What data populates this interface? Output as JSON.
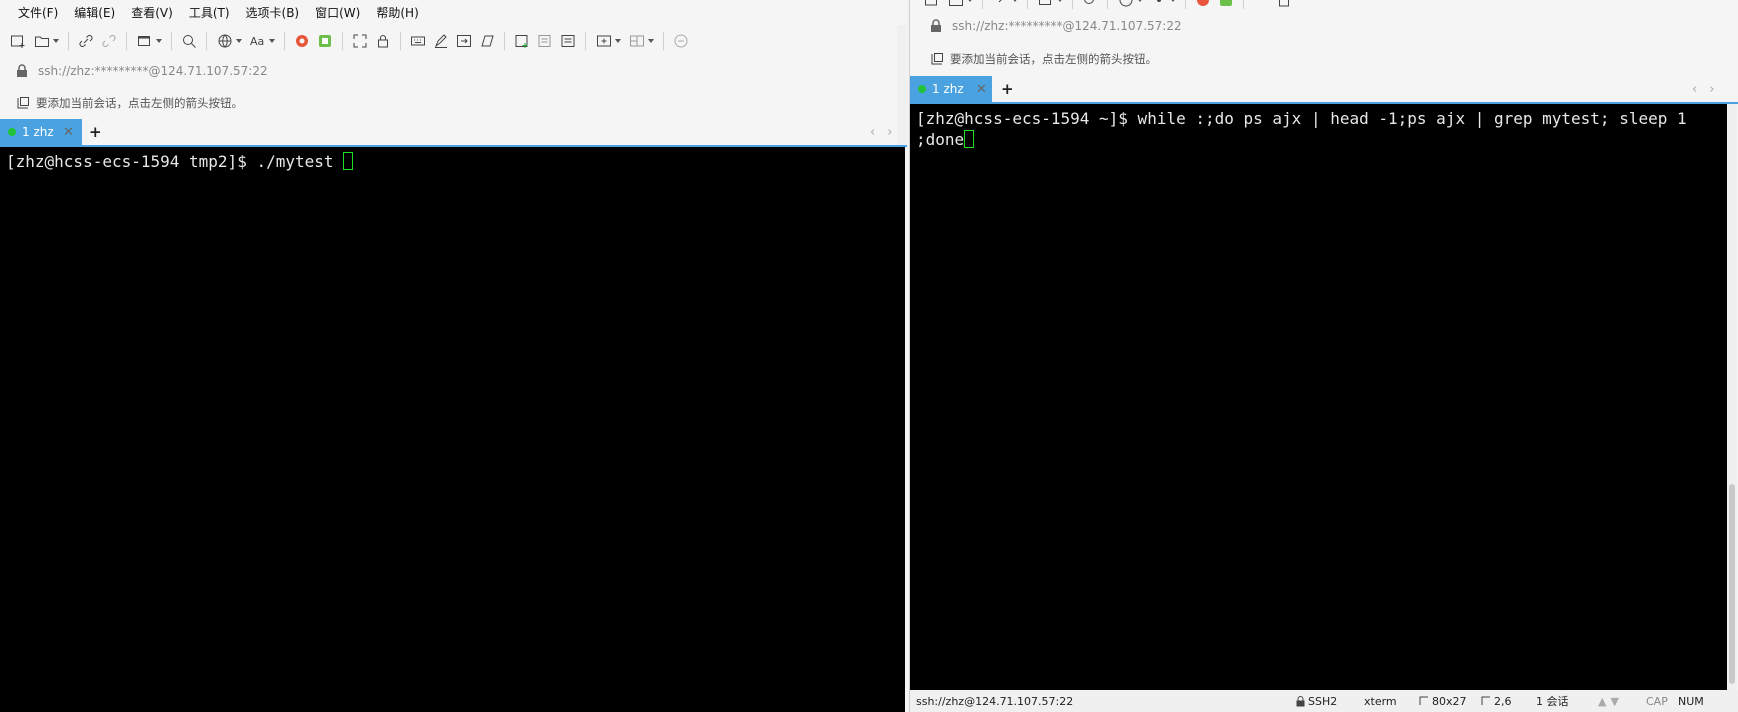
{
  "left": {
    "menu": [
      "文件(F)",
      "编辑(E)",
      "查看(V)",
      "工具(T)",
      "选项卡(B)",
      "窗口(W)",
      "帮助(H)"
    ],
    "address": "ssh://zhz:*********@124.71.107.57:22",
    "hint": "要添加当前会话，点击左侧的箭头按钮。",
    "tab_label": "1 zhz",
    "terminal_line": "[zhz@hcss-ecs-1594 tmp2]$ ./mytest "
  },
  "right": {
    "address": "ssh://zhz:*********@124.71.107.57:22",
    "hint": "要添加当前会话，点击左侧的箭头按钮。",
    "tab_label": "1 zhz",
    "terminal_line1": "[zhz@hcss-ecs-1594 ~]$ while :;do ps ajx | head -1;ps ajx | grep mytest; sleep 1",
    "terminal_line2": ";done"
  },
  "status": {
    "address": "ssh://zhz@124.71.107.57:22",
    "protocol": "SSH2",
    "term_type": "xterm",
    "size": "80x27",
    "cursor_pos": "2,6",
    "sessions": "1 会话",
    "caps": "CAP",
    "num": "NUM"
  },
  "colors": {
    "tab_active": "#4aa3e0",
    "session_dot": "#23c23a",
    "cursor": "#20e020",
    "terminal_bg": "#000000"
  }
}
